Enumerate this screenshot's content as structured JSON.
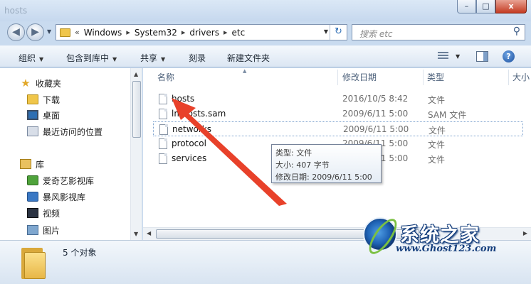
{
  "window": {
    "title": "hosts",
    "minimize_glyph": "–",
    "maximize_glyph": "□",
    "close_glyph": "x"
  },
  "nav": {
    "back_glyph": "◀",
    "forward_glyph": "▶",
    "dropdown_glyph": "▼"
  },
  "address": {
    "overflow": "«",
    "separator": "▸",
    "crumbs": [
      "Windows",
      "System32",
      "drivers",
      "etc"
    ],
    "refresh_glyph": "↻"
  },
  "search": {
    "placeholder": "搜索 etc",
    "icon_glyph": "⚲"
  },
  "toolbar": {
    "organize": "组织",
    "include_in_library": "包含到库中",
    "share": "共享",
    "burn": "刻录",
    "new_folder": "新建文件夹",
    "help_glyph": "?"
  },
  "sidebar": {
    "favorites": "收藏夹",
    "downloads": "下载",
    "desktop": "桌面",
    "recent": "最近访问的位置",
    "libraries": "库",
    "iqiyi": "爱奇艺影视库",
    "storm": "暴风影视库",
    "videos": "视频",
    "pictures": "图片",
    "star_glyph": "★"
  },
  "columns": {
    "name": "名称",
    "modified": "修改日期",
    "type": "类型",
    "size": "大小"
  },
  "files": [
    {
      "name": "hosts",
      "modified": "2016/10/5 8:42",
      "type": "文件"
    },
    {
      "name": "lmhosts.sam",
      "modified": "2009/6/11 5:00",
      "type": "SAM 文件"
    },
    {
      "name": "networks",
      "modified": "2009/6/11 5:00",
      "type": "文件"
    },
    {
      "name": "protocol",
      "modified": "2009/6/11 5:00",
      "type": "文件"
    },
    {
      "name": "services",
      "modified": "2009/6/11 5:00",
      "type": "文件"
    }
  ],
  "tooltip": {
    "type": "类型: 文件",
    "size": "大小: 407 字节",
    "modified": "修改日期: 2009/6/11 5:00"
  },
  "details": {
    "count": "5 个对象"
  },
  "watermark": {
    "title": "系统之家",
    "url": "www.Ghost123.com"
  },
  "colors": {
    "annotation_arrow": "#e8412a",
    "accent": "#2e6fb3"
  }
}
